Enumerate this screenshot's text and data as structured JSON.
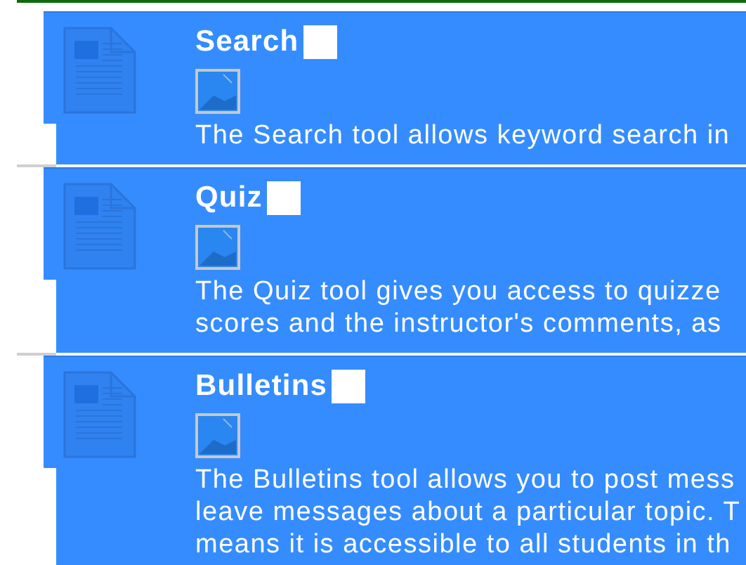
{
  "tools": [
    {
      "title": "Search",
      "description_lines": [
        "The Search tool allows keyword search in"
      ]
    },
    {
      "title": "Quiz",
      "description_lines": [
        "The Quiz tool gives you access to quizze",
        "scores and the instructor's comments, as"
      ]
    },
    {
      "title": "Bulletins",
      "description_lines": [
        "The Bulletins tool allows you to post mess",
        "leave messages about a particular topic. T",
        "means it is accessible to all students in th"
      ]
    }
  ]
}
